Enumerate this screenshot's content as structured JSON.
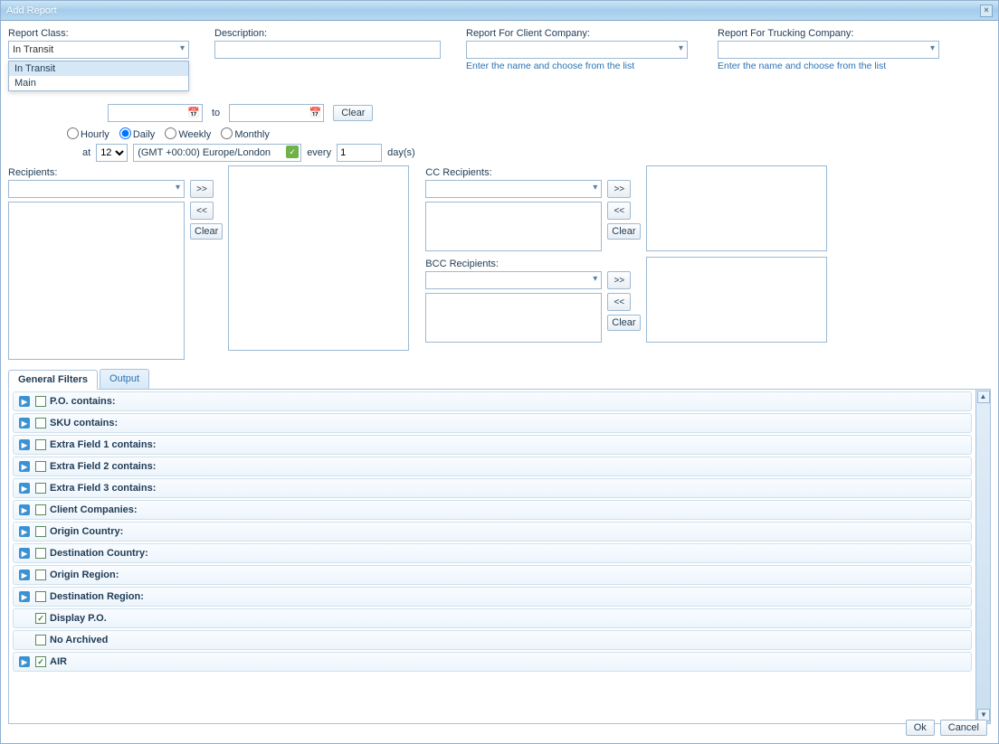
{
  "window": {
    "title": "Add Report"
  },
  "form": {
    "report_class_label": "Report Class:",
    "report_class_value": "In Transit",
    "report_class_options": [
      "In Transit",
      "Main"
    ],
    "description_label": "Description:",
    "client_company_label": "Report For Client Company:",
    "client_company_hint": "Enter the name and choose from the list",
    "trucking_company_label": "Report For Trucking Company:",
    "trucking_company_hint": "Enter the name and choose from the list",
    "to_label": "to",
    "clear_label": "Clear",
    "freq": {
      "hourly": "Hourly",
      "daily": "Daily",
      "weekly": "Weekly",
      "monthly": "Monthly",
      "selected": "Daily"
    },
    "at_label": "at",
    "at_hour": "12",
    "tz": "(GMT +00:00) Europe/London",
    "every_label": "every",
    "every_value": "1",
    "days_label": "day(s)"
  },
  "recipients": {
    "label": "Recipients:",
    "cc_label": "CC Recipients:",
    "bcc_label": "BCC Recipients:",
    "add_btn": ">>",
    "remove_btn": "<<",
    "clear_btn": "Clear"
  },
  "tabs": {
    "general": "General Filters",
    "output": "Output"
  },
  "filters": [
    {
      "label": "P.O. contains:",
      "checked": false,
      "expandable": true
    },
    {
      "label": "SKU contains:",
      "checked": false,
      "expandable": true
    },
    {
      "label": "Extra Field 1 contains:",
      "checked": false,
      "expandable": true
    },
    {
      "label": "Extra Field 2 contains:",
      "checked": false,
      "expandable": true
    },
    {
      "label": "Extra Field 3 contains:",
      "checked": false,
      "expandable": true
    },
    {
      "label": "Client Companies:",
      "checked": false,
      "expandable": true
    },
    {
      "label": "Origin Country:",
      "checked": false,
      "expandable": true
    },
    {
      "label": "Destination Country:",
      "checked": false,
      "expandable": true
    },
    {
      "label": "Origin Region:",
      "checked": false,
      "expandable": true
    },
    {
      "label": "Destination Region:",
      "checked": false,
      "expandable": true
    },
    {
      "label": "Display P.O.",
      "checked": true,
      "expandable": false
    },
    {
      "label": "No Archived",
      "checked": false,
      "expandable": false
    },
    {
      "label": "AIR",
      "checked": true,
      "expandable": true
    }
  ],
  "buttons": {
    "ok": "Ok",
    "cancel": "Cancel"
  }
}
